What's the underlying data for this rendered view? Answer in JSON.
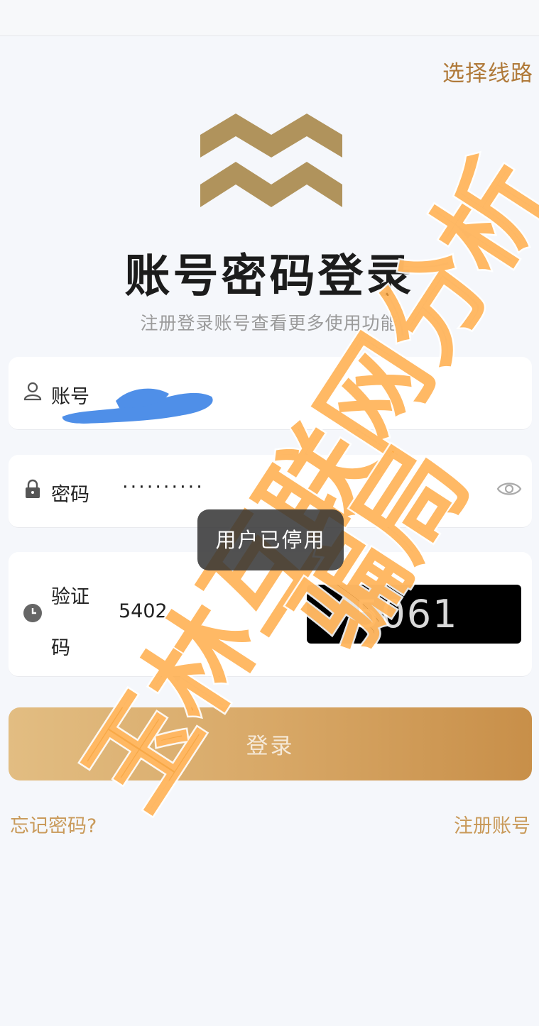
{
  "header": {
    "route_link": "选择线路"
  },
  "logo": {
    "name": "brand-logo",
    "color": "#b0935c"
  },
  "title": "账号密码登录",
  "subtitle": "注册登录账号查看更多使用功能",
  "account": {
    "label": "账号",
    "value": ""
  },
  "password": {
    "label": "密码",
    "value": "··········"
  },
  "captcha": {
    "label_line1": "验证",
    "label_line2": "码",
    "value": "5402",
    "image_text": "5061"
  },
  "login_button": "登录",
  "forgot_link": "忘记密码?",
  "register_link": "注册账号",
  "toast": "用户已停用",
  "watermark": {
    "line1": "玉林互联网分析",
    "line2": "骗局"
  },
  "colors": {
    "accent": "#c99a5a",
    "brand_gold": "#b0935c",
    "watermark_orange": "#ffa53a",
    "redaction_blue": "#4f8fe8"
  }
}
